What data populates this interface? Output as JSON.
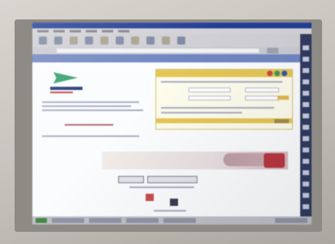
{
  "photo": {
    "subject": "",
    "monitor_brand": "",
    "screen_visible_text": []
  },
  "colors": {
    "bezel": "#c7c5bd",
    "titlebar": "#1f3ea1",
    "accent_yellow": "#e8c54a",
    "logo_green": "#2da46b"
  }
}
